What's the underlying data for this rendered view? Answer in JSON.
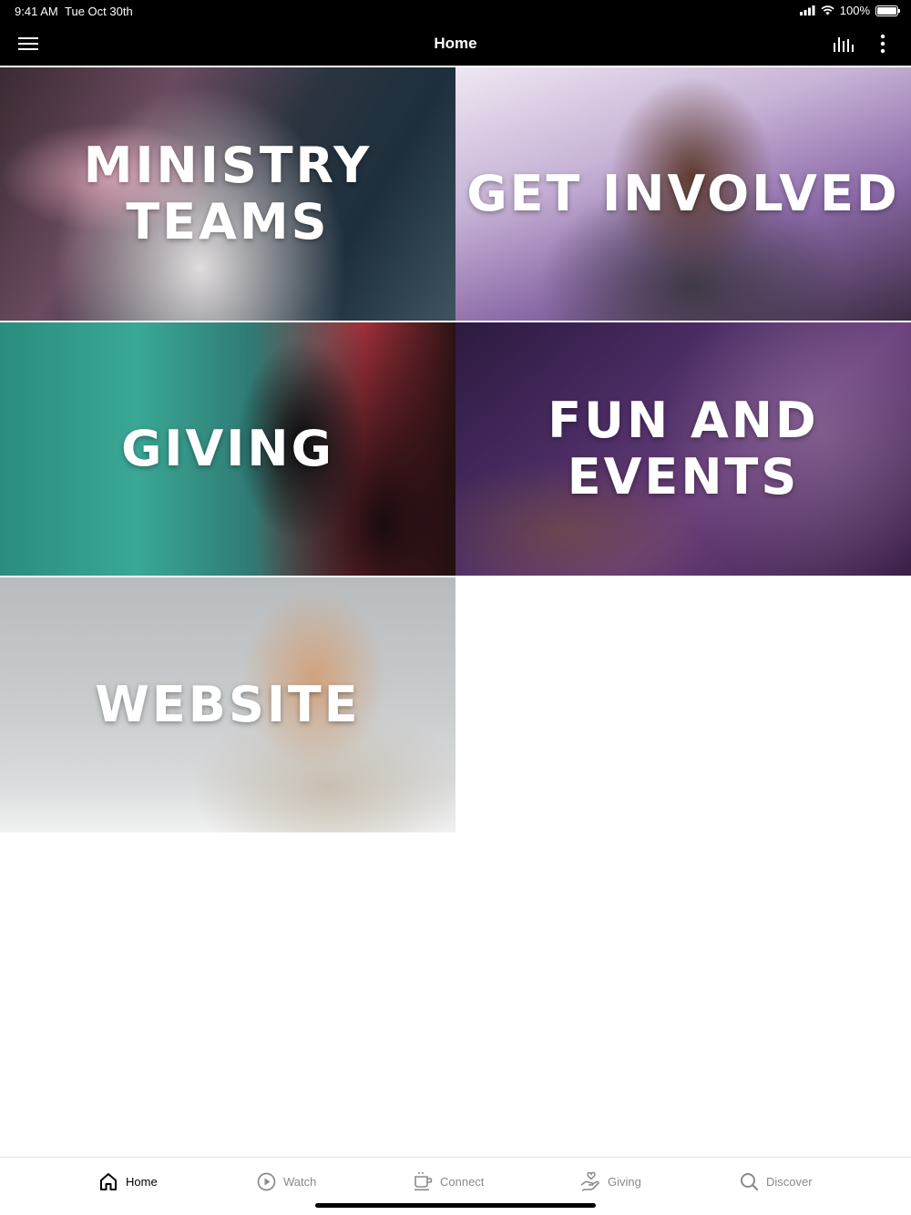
{
  "status_bar": {
    "time": "9:41 AM",
    "date": "Tue Oct 30th",
    "battery": "100%"
  },
  "nav": {
    "title": "Home",
    "left_icon": "hamburger-menu-icon",
    "right_icons": [
      "bar-chart-icon",
      "more-vertical-icon"
    ]
  },
  "tiles": [
    {
      "lines": [
        "MINISTRY",
        "TEAMS"
      ]
    },
    {
      "lines": [
        "GET INVOLVED"
      ]
    },
    {
      "lines": [
        "GIVING"
      ]
    },
    {
      "lines": [
        "FUN AND",
        "EVENTS"
      ]
    },
    {
      "lines": [
        "WEBSITE"
      ]
    }
  ],
  "tab_bar": {
    "items": [
      {
        "label": "Home",
        "icon": "home-icon",
        "active": true
      },
      {
        "label": "Watch",
        "icon": "play-circle-icon",
        "active": false
      },
      {
        "label": "Connect",
        "icon": "coffee-cup-icon",
        "active": false
      },
      {
        "label": "Giving",
        "icon": "giving-hand-icon",
        "active": false
      },
      {
        "label": "Discover",
        "icon": "search-icon",
        "active": false
      }
    ]
  }
}
